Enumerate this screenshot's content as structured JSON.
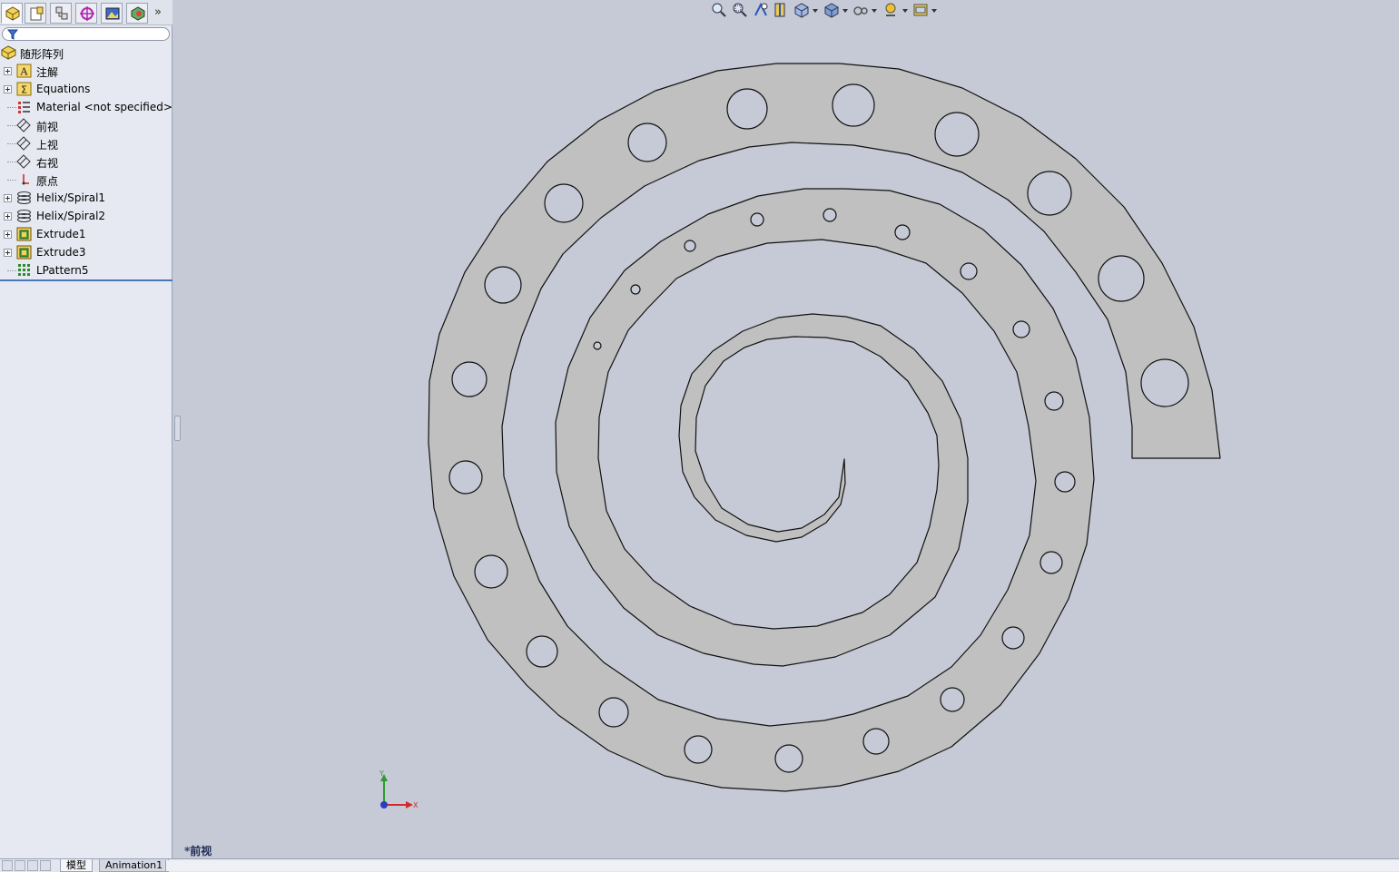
{
  "feature_tree": {
    "root": {
      "label": "随形阵列",
      "icon": "part-icon"
    },
    "items": [
      {
        "label": "注解",
        "icon": "annotations-icon",
        "expandable": true
      },
      {
        "label": "Equations",
        "icon": "equations-icon",
        "expandable": true
      },
      {
        "label": "Material <not specified>",
        "icon": "material-icon",
        "expandable": false
      },
      {
        "label": "前视",
        "icon": "plane-icon",
        "expandable": false
      },
      {
        "label": "上视",
        "icon": "plane-icon",
        "expandable": false
      },
      {
        "label": "右视",
        "icon": "plane-icon",
        "expandable": false
      },
      {
        "label": "原点",
        "icon": "origin-icon",
        "expandable": false
      },
      {
        "label": "Helix/Spiral1",
        "icon": "helix-icon",
        "expandable": true
      },
      {
        "label": "Helix/Spiral2",
        "icon": "helix-icon",
        "expandable": true
      },
      {
        "label": "Extrude1",
        "icon": "extrude-icon",
        "expandable": true
      },
      {
        "label": "Extrude3",
        "icon": "extrude-icon",
        "expandable": true
      },
      {
        "label": "LPattern5",
        "icon": "linear-pattern-icon",
        "expandable": false
      }
    ]
  },
  "panel_tabs": [
    "feature-manager-tab",
    "property-manager-tab",
    "configuration-manager-tab",
    "dimxpert-tab",
    "display-manager-tab",
    "appearance-tab"
  ],
  "more_tabs_glyph": "»",
  "graphics": {
    "view_name": "*前视",
    "triad": {
      "x_label": "X",
      "y_label": "Y"
    }
  },
  "bottom_tabs": {
    "model": "模型",
    "animation": "Animation1"
  },
  "colors": {
    "part_fill": "#c0c0c0",
    "background": "#c5cad6",
    "panel": "#e6e9f1",
    "accent": "#4a74b8"
  }
}
